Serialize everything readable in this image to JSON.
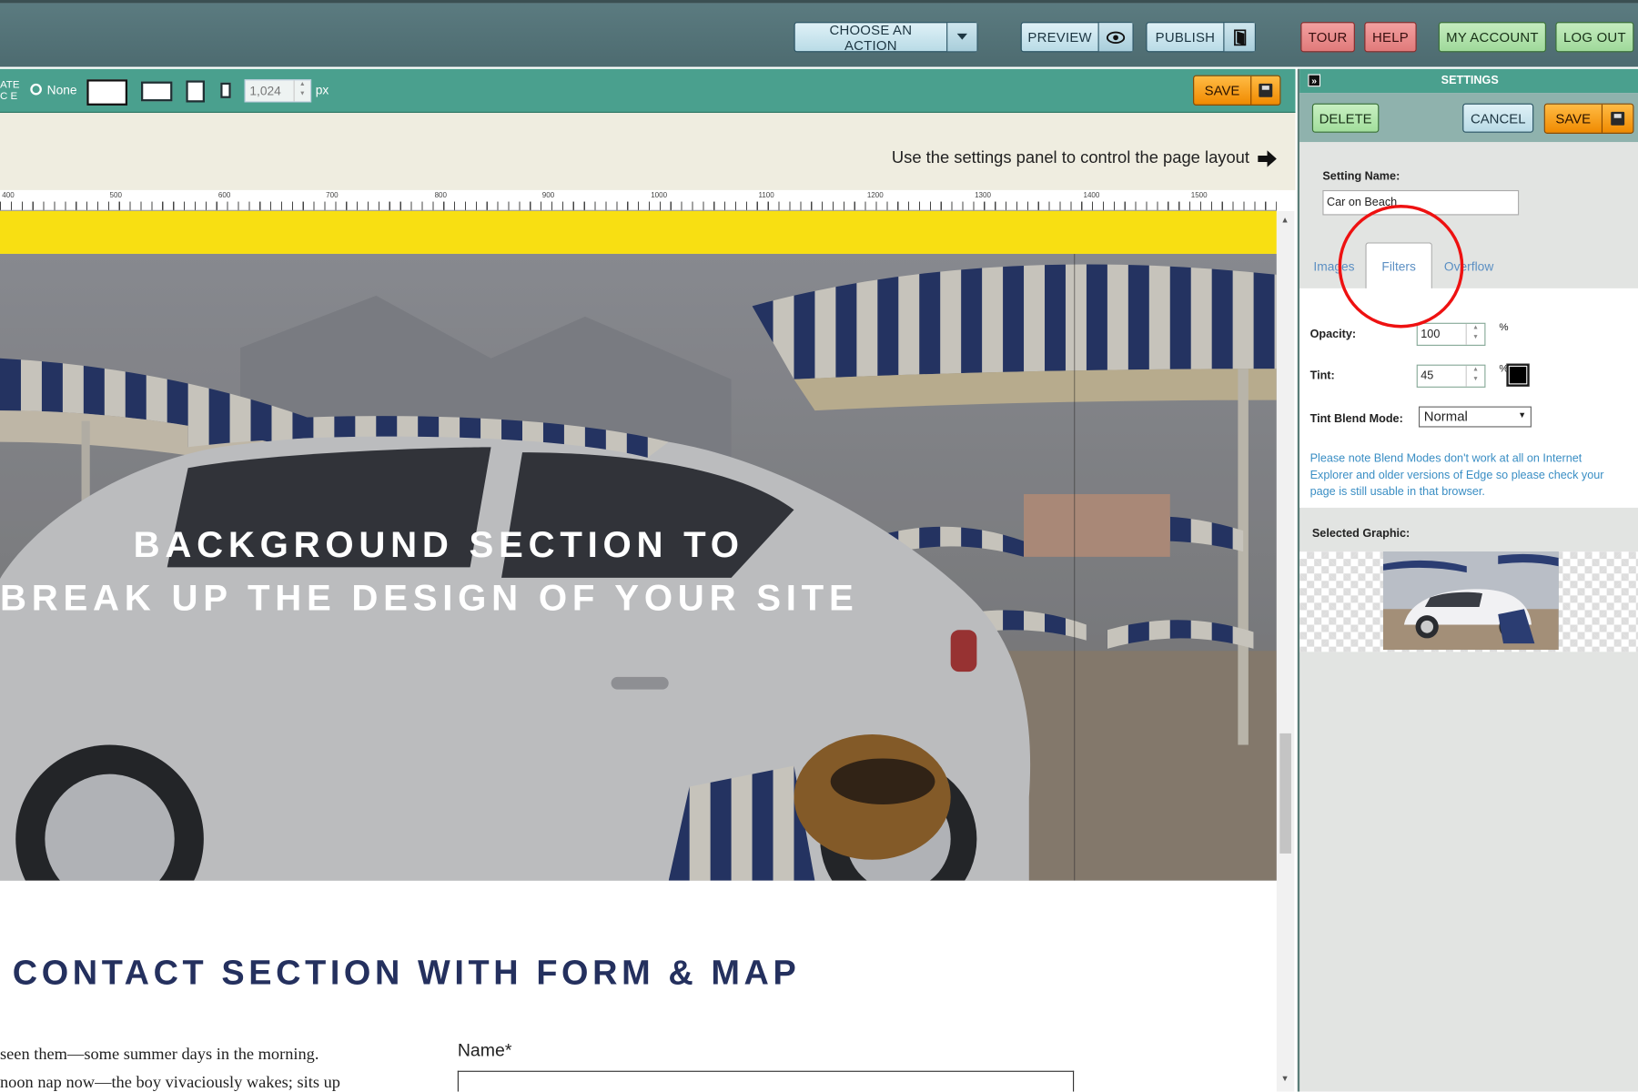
{
  "topbar": {
    "choose_action": "CHOOSE AN ACTION",
    "preview": "PREVIEW",
    "publish": "PUBLISH",
    "tour": "TOUR",
    "help": "HELP",
    "my_account": "MY ACCOUNT",
    "log_out": "LOG OUT"
  },
  "editbar": {
    "rotate_label_1": "ATE",
    "rotate_label_2": "C E",
    "none_label": "None",
    "width_value": "1,024",
    "unit": "px",
    "save": "SAVE"
  },
  "canvas": {
    "hint": "Use the settings panel to control the page layout",
    "ruler_labels": [
      "400",
      "500",
      "600",
      "700",
      "800",
      "900",
      "1000",
      "1100",
      "1200",
      "1300",
      "1400",
      "1500"
    ],
    "hero_line1": "BACKGROUND SECTION TO",
    "hero_line2": "BREAK UP THE DESIGN OF YOUR SITE",
    "contact_title": "CONTACT SECTION WITH FORM & MAP",
    "para_line1": "seen them—some summer days in the morning.",
    "para_line2": "noon nap now—the boy vivaciously wakes; sits up",
    "name_label": "Name*"
  },
  "settings": {
    "title": "SETTINGS",
    "delete": "DELETE",
    "cancel": "CANCEL",
    "save": "SAVE",
    "setting_name_label": "Setting Name:",
    "setting_name_value": "Car on Beach",
    "tabs": [
      "Images",
      "Filters",
      "Overflow"
    ],
    "active_tab": "Filters",
    "opacity_label": "Opacity:",
    "opacity_value": "100",
    "tint_label": "Tint:",
    "tint_value": "45",
    "percent": "%",
    "tint_color": "#000000",
    "blend_label": "Tint Blend Mode:",
    "blend_value": "Normal",
    "note": "Please note Blend Modes don't work at all on Internet Explorer and older versions of Edge so please check your page is still usable in that browser.",
    "selected_graphic_label": "Selected Graphic:"
  },
  "colors": {
    "accent_teal": "#4aa08e",
    "yellow_band": "#f8df12",
    "contact_title": "#24305e",
    "annotation_circle": "#e11111"
  }
}
